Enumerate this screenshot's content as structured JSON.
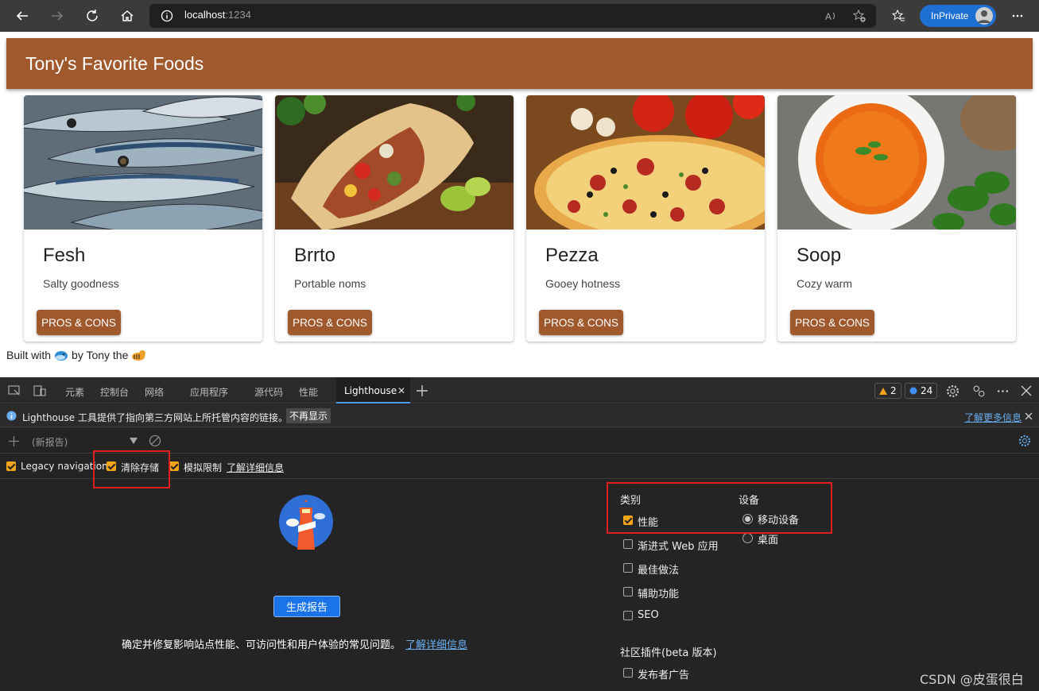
{
  "browser": {
    "url_host": "localhost",
    "url_port": ":1234",
    "inprivate_label": "InPrivate"
  },
  "page": {
    "title": "Tony's Favorite Foods",
    "cards": [
      {
        "title": "Fesh",
        "subtitle": "Salty goodness",
        "button": "PROS & CONS",
        "image": "fish"
      },
      {
        "title": "Brrto",
        "subtitle": "Portable noms",
        "button": "PROS & CONS",
        "image": "burrito"
      },
      {
        "title": "Pezza",
        "subtitle": "Gooey hotness",
        "button": "PROS & CONS",
        "image": "pizza"
      },
      {
        "title": "Soop",
        "subtitle": "Cozy warm",
        "button": "PROS & CONS",
        "image": "soup"
      }
    ],
    "footer": {
      "built_with": "Built with",
      "by": "by Tony the"
    }
  },
  "devtools": {
    "tabs": [
      "元素",
      "控制台",
      "网络",
      "应用程序",
      "源代码",
      "性能",
      "Lighthouse"
    ],
    "warnings_count": "2",
    "messages_count": "24",
    "info": {
      "text": "Lighthouse 工具提供了指向第三方网站上所托管内容的链接。",
      "dismiss": "不再显示",
      "learn_more": "了解更多信息"
    },
    "report_select": "(新报告)",
    "options": {
      "legacy": "Legacy navigation",
      "clear_storage": "清除存储",
      "throttling": "模拟限制",
      "learn_link": "了解详细信息"
    },
    "generate_button": "生成报告",
    "description": "确定并修复影响站点性能、可访问性和用户体验的常见问题。",
    "description_link": "了解详细信息",
    "categories_title": "类别",
    "categories": [
      {
        "label": "性能",
        "checked": true
      },
      {
        "label": "渐进式 Web 应用",
        "checked": false
      },
      {
        "label": "最佳做法",
        "checked": false
      },
      {
        "label": "辅助功能",
        "checked": false
      },
      {
        "label": "SEO",
        "checked": false
      }
    ],
    "device_title": "设备",
    "devices": [
      {
        "label": "移动设备",
        "selected": true
      },
      {
        "label": "桌面",
        "selected": false
      }
    ],
    "plugins_title": "社区插件(beta 版本)",
    "plugins": [
      {
        "label": "发布者广告",
        "checked": false
      }
    ]
  },
  "watermark": "CSDN @皮蛋很白",
  "colors": {
    "brand": "#a0592d",
    "accent": "#f4a51c",
    "link": "#6aaef0"
  }
}
